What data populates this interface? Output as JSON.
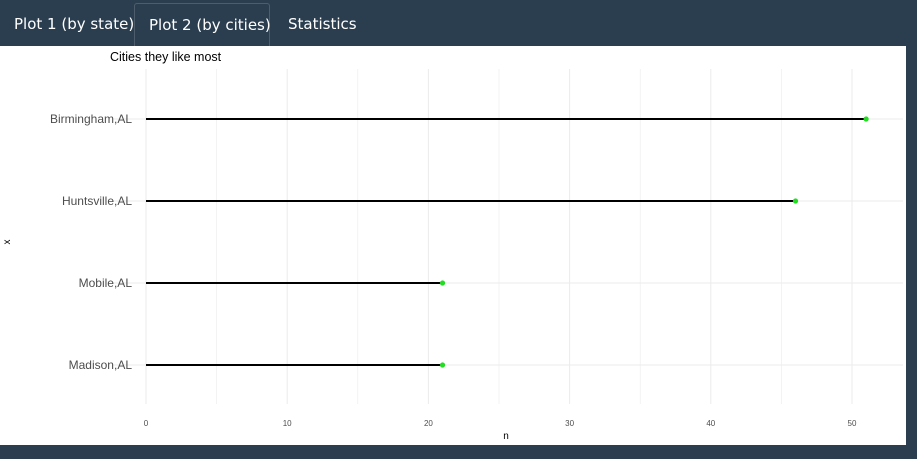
{
  "tabs": [
    {
      "label": "Plot 1 (by state)",
      "active": false
    },
    {
      "label": "Plot 2 (by cities)",
      "active": true
    },
    {
      "label": "Statistics",
      "active": false
    }
  ],
  "colors": {
    "navbar": "#2b3e50",
    "segment": "#000000",
    "point": "#22dd22",
    "grid": "#ebebeb"
  },
  "chart_data": {
    "type": "lollipop",
    "title": "Cities they like most",
    "xlabel": "n",
    "ylabel": "x",
    "xlim": [
      0,
      53
    ],
    "xticks": [
      0,
      10,
      20,
      30,
      40,
      50
    ],
    "categories": [
      "Birmingham,AL",
      "Huntsville,AL",
      "Mobile,AL",
      "Madison,AL"
    ],
    "values": [
      51,
      46,
      21,
      21
    ],
    "grid": true
  }
}
